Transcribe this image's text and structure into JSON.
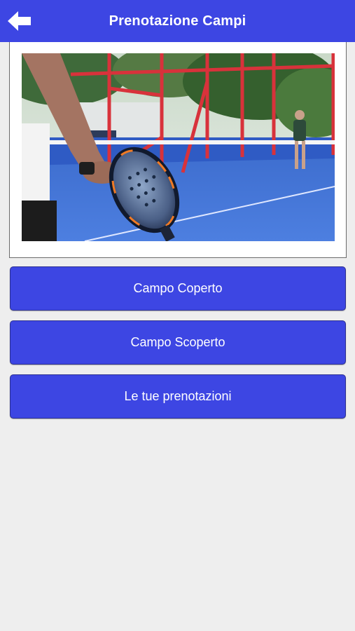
{
  "header": {
    "title": "Prenotazione Campi",
    "back_icon": "arrow-left-icon",
    "background_color": "#3d46e3"
  },
  "hero": {
    "image": "padel-court-photo"
  },
  "buttons": {
    "covered_court": "Campo Coperto",
    "outdoor_court": "Campo Scoperto",
    "my_bookings": "Le tue prenotazioni"
  },
  "colors": {
    "accent": "#3d46e3",
    "background": "#eeeeee"
  }
}
